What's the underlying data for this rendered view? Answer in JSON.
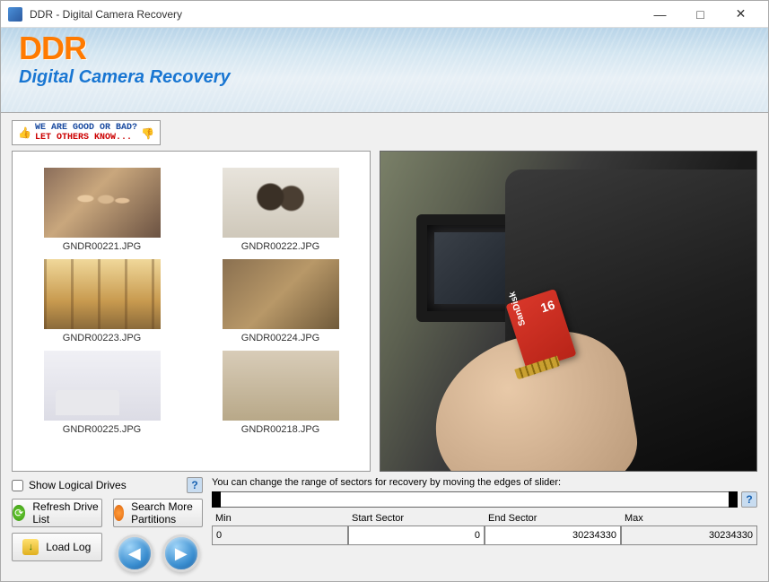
{
  "window": {
    "title": "DDR - Digital Camera Recovery"
  },
  "header": {
    "logo": "DDR",
    "subtitle": "Digital Camera Recovery"
  },
  "feedback": {
    "line1": "WE ARE GOOD OR BAD?",
    "line2": "LET OTHERS KNOW..."
  },
  "thumbs": [
    {
      "caption": "GNDR00221.JPG"
    },
    {
      "caption": "GNDR00222.JPG"
    },
    {
      "caption": "GNDR00223.JPG"
    },
    {
      "caption": "GNDR00224.JPG"
    },
    {
      "caption": "GNDR00225.JPG"
    },
    {
      "caption": "GNDR00218.JPG"
    }
  ],
  "checkbox": {
    "label": "Show Logical Drives",
    "checked": false
  },
  "buttons": {
    "refresh": "Refresh Drive List",
    "search": "Search More Partitions",
    "load": "Load Log"
  },
  "sector": {
    "hint": "You can change the range of sectors for recovery by moving the edges of slider:",
    "min_label": "Min",
    "start_label": "Start Sector",
    "end_label": "End Sector",
    "max_label": "Max",
    "min": "0",
    "start": "0",
    "end": "30234330",
    "max": "30234330"
  },
  "help": "?"
}
